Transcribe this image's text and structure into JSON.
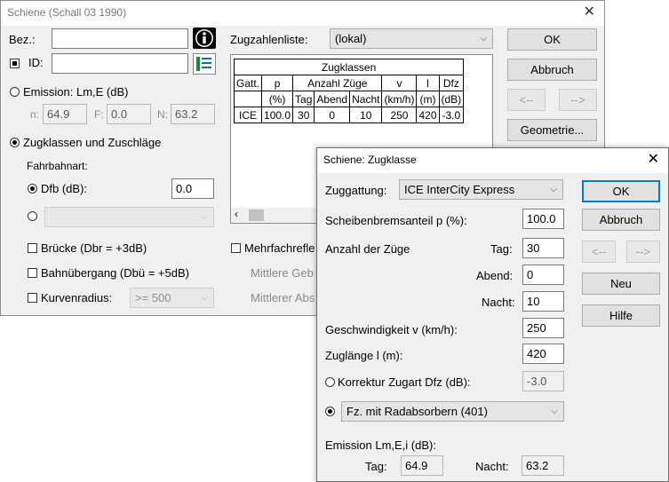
{
  "main_dialog": {
    "title": "Schiene (Schall 03 1990)",
    "bez_label": "Bez.:",
    "bez_value": "",
    "id_label": "ID:",
    "id_value": "",
    "emission_label": "Emission: Lm,E (dB)",
    "emission_n_label": "n:",
    "emission_n_value": "64.9",
    "emission_f_label": "F:",
    "emission_f_value": "0.0",
    "emission_n2_label": "N:",
    "emission_n2_value": "63.2",
    "zugklassen_label": "Zugklassen und Zuschläge",
    "fahrbahnart_label": "Fahrbahnart:",
    "dfb_label": "Dfb (dB):",
    "dfb_value": "0.0",
    "bruecke_label": "Brücke (Dbr = +3dB)",
    "bahnuebergang_label": "Bahnübergang (Dbü = +5dB)",
    "kurvenradius_label": "Kurvenradius:",
    "kurvenradius_value": ">= 500",
    "mehrfach_label": "Mehrfachrefle",
    "mittlere_geb_label": "Mittlere Geb",
    "mittlerer_abs_label": "Mittlerer Abs",
    "zugzahlenliste_label": "Zugzahlenliste:",
    "zugzahlenliste_value": "(lokal)",
    "ok_label": "OK",
    "abbruch_label": "Abbruch",
    "prev_label": "<--",
    "next_label": "-->",
    "geometrie_label": "Geometrie...",
    "table": {
      "title": "Zugklassen",
      "header1": [
        "Gatt.",
        "p",
        "Anzahl Züge",
        "v",
        "l",
        "Dfz"
      ],
      "header2": [
        "",
        "(%)",
        "Tag",
        "Abend",
        "Nacht",
        "(km/h)",
        "(m)",
        "(dB)"
      ],
      "row": [
        "ICE",
        "100.0",
        "30",
        "0",
        "10",
        "250",
        "420",
        "-3.0"
      ]
    }
  },
  "sub_dialog": {
    "title": "Schiene: Zugklasse",
    "zuggattung_label": "Zuggattung:",
    "zuggattung_value": "ICE  InterCity Express",
    "scheibenbrems_label": "Scheibenbremsanteil p (%):",
    "scheibenbrems_value": "100.0",
    "anzahl_label": "Anzahl der Züge",
    "tag_label": "Tag:",
    "tag_value": "30",
    "abend_label": "Abend:",
    "abend_value": "0",
    "nacht_label": "Nacht:",
    "nacht_value": "10",
    "geschw_label": "Geschwindigkeit v (km/h):",
    "geschw_value": "250",
    "zuglaenge_label": "Zuglänge l (m):",
    "zuglaenge_value": "420",
    "korrektur_label": "Korrektur Zugart Dfz (dB):",
    "korrektur_value": "-3.0",
    "fz_value": "Fz. mit Radabsorbern (401)",
    "emission_label": "Emission Lm,E,i (dB):",
    "em_tag_label": "Tag:",
    "em_tag_value": "64.9",
    "em_nacht_label": "Nacht:",
    "em_nacht_value": "63.2",
    "ok_label": "OK",
    "abbruch_label": "Abbruch",
    "prev_label": "<--",
    "next_label": "-->",
    "neu_label": "Neu",
    "hilfe_label": "Hilfe"
  }
}
